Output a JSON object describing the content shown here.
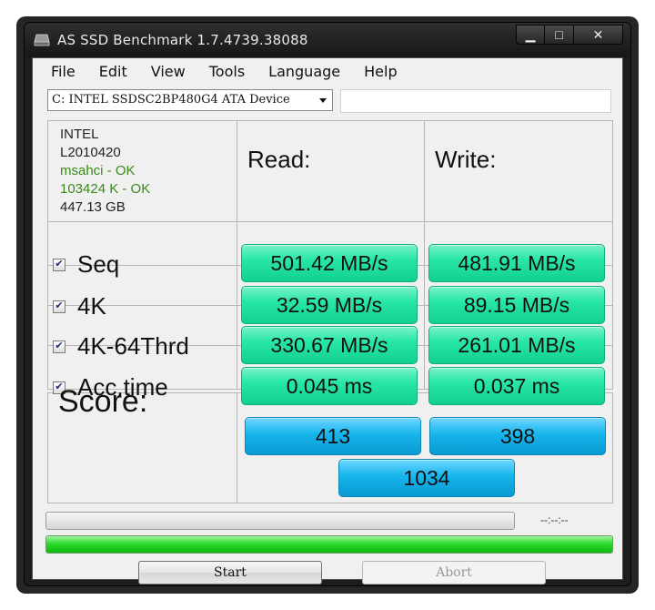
{
  "window": {
    "title": "AS SSD Benchmark 1.7.4739.38088",
    "controls": {
      "minimize": "▁",
      "maximize": "□",
      "close": "✕"
    }
  },
  "menu": [
    "File",
    "Edit",
    "View",
    "Tools",
    "Language",
    "Help"
  ],
  "device": {
    "selected": "C: INTEL SSDSC2BP480G4 ATA Device",
    "extra_field": ""
  },
  "drive_info": {
    "vendor": "INTEL",
    "firmware": "L2010420",
    "driver_status": "msahci - OK",
    "alignment_status": "103424 K - OK",
    "capacity": "447.13 GB"
  },
  "columns": {
    "read": "Read:",
    "write": "Write:"
  },
  "tests": [
    {
      "label": "Seq",
      "checked": true,
      "read": "501.42 MB/s",
      "write": "481.91 MB/s"
    },
    {
      "label": "4K",
      "checked": true,
      "read": "32.59 MB/s",
      "write": "89.15 MB/s"
    },
    {
      "label": "4K-64Thrd",
      "checked": true,
      "read": "330.67 MB/s",
      "write": "261.01 MB/s"
    },
    {
      "label": "Acc.time",
      "checked": true,
      "read": "0.045 ms",
      "write": "0.037 ms"
    }
  ],
  "score": {
    "label": "Score:",
    "read": "413",
    "write": "398",
    "total": "1034"
  },
  "progress": {
    "time": "--:--:--",
    "current_fraction": 0.0,
    "overall_fraction": 1.0
  },
  "buttons": {
    "start": "Start",
    "abort": "Abort"
  },
  "colors": {
    "result_green": "#28e7a6",
    "score_blue": "#16b5ec",
    "progress_green": "#2fdb2f"
  },
  "icons": {
    "app": "drive-icon",
    "checkbox": "checkmark-icon"
  }
}
